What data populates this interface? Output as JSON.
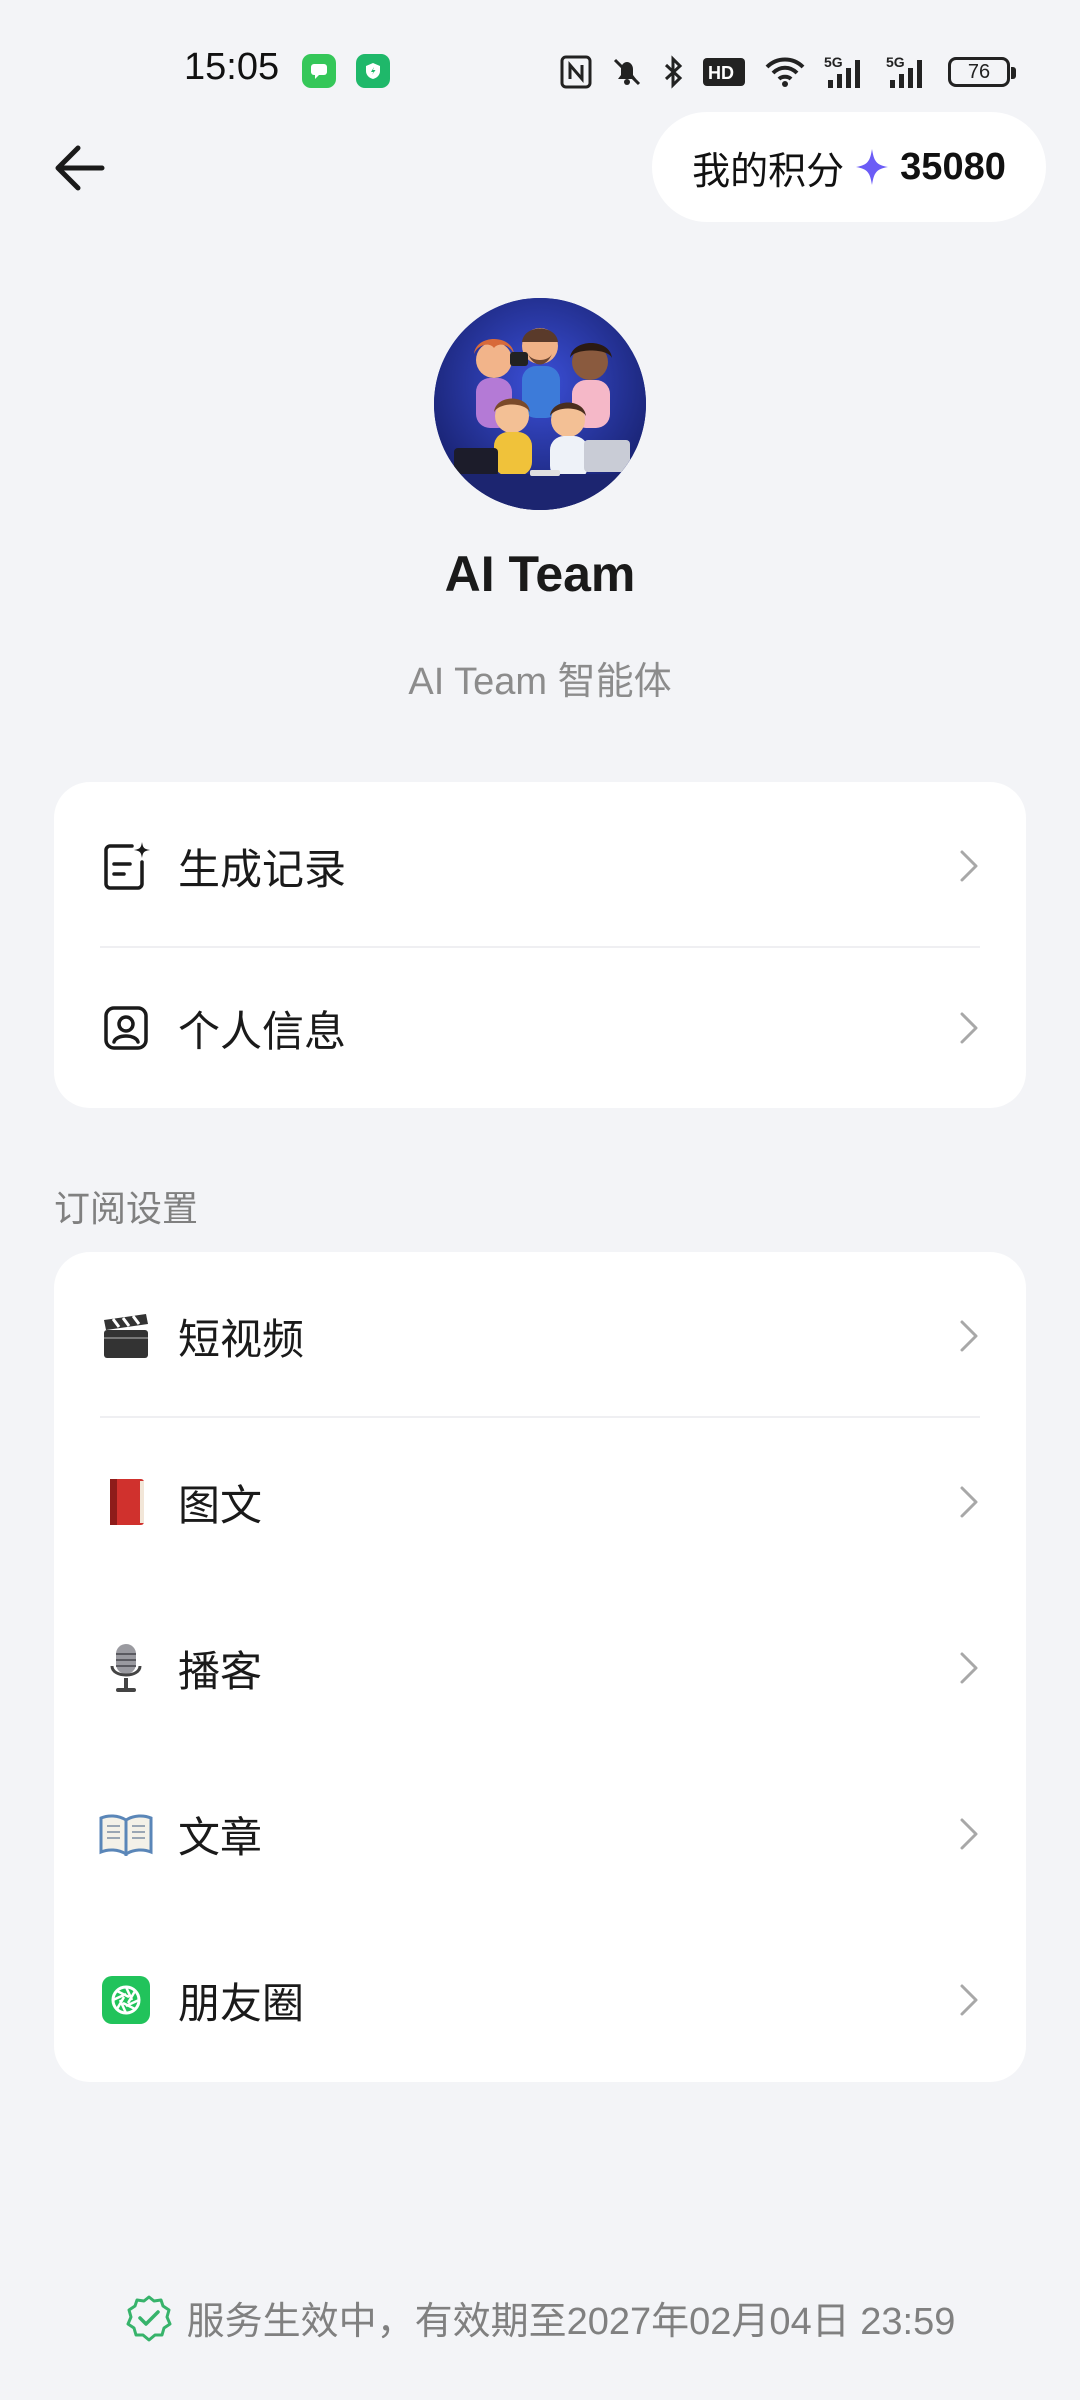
{
  "status_bar": {
    "time": "15:05",
    "battery": "76",
    "network_1": "5G",
    "network_2": "5G",
    "hd_label": "HD"
  },
  "header": {
    "back_icon": "arrow-left-icon",
    "points_label": "我的积分",
    "points_icon": "sparkle-icon",
    "points_value": "35080",
    "accent": "#6b5cf6"
  },
  "profile": {
    "name": "AI Team",
    "subtitle": "AI Team 智能体"
  },
  "menu_main": [
    {
      "label": "生成记录",
      "icon": "document-sparkle-icon"
    },
    {
      "label": "个人信息",
      "icon": "contact-card-icon"
    }
  ],
  "subscription": {
    "title": "订阅设置",
    "items": [
      {
        "label": "短视频",
        "icon": "clapperboard-icon"
      },
      {
        "label": "图文",
        "icon": "red-book-icon"
      },
      {
        "label": "播客",
        "icon": "microphone-icon"
      },
      {
        "label": "文章",
        "icon": "open-book-icon"
      },
      {
        "label": "朋友圈",
        "icon": "moments-icon"
      }
    ]
  },
  "footer": {
    "status_text": "服务生效中，有效期至2027年02月04日 23:59",
    "status_icon": "check-badge-icon",
    "status_color": "#37b36b"
  }
}
